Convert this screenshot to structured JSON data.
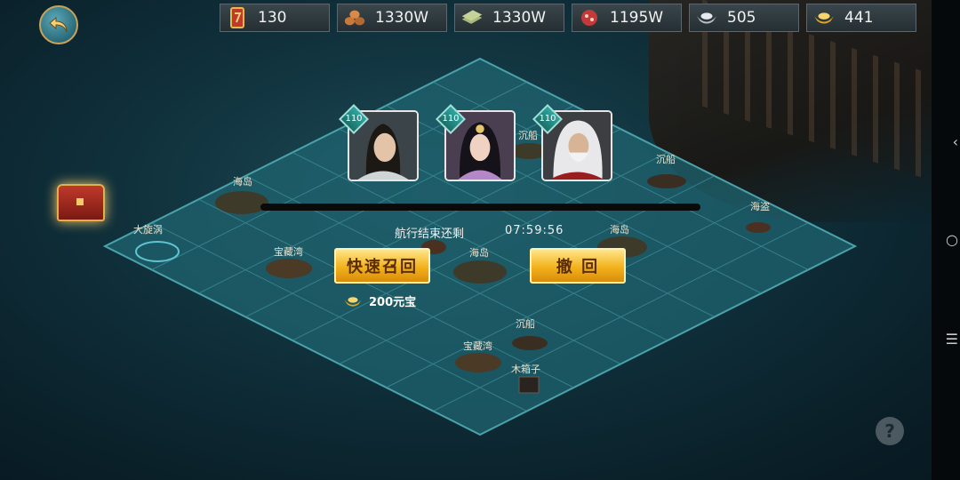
{
  "resources": [
    {
      "icon": "token-icon",
      "value": "130"
    },
    {
      "icon": "wood-icon",
      "value": "1330W"
    },
    {
      "icon": "cloth-icon",
      "value": "1330W"
    },
    {
      "icon": "meat-icon",
      "value": "1195W"
    },
    {
      "icon": "silver-ingot-icon",
      "value": "505"
    },
    {
      "icon": "gold-ingot-icon",
      "value": "441"
    }
  ],
  "heroes": [
    {
      "level": "110"
    },
    {
      "level": "110"
    },
    {
      "level": "110"
    }
  ],
  "map_labels": [
    "海岛",
    "大旋涡",
    "宝藏湾",
    "海岛",
    "沉船",
    "海盗",
    "海岛",
    "沉船",
    "宝藏湾",
    "木箱子",
    "沉船"
  ],
  "voyage": {
    "label": "航行结束还剩",
    "time": "07:59:56"
  },
  "buttons": {
    "quick_recall": "快速召回",
    "withdraw": "撤 回"
  },
  "cost": {
    "amount": "200元宝",
    "icon": "gold-ingot-icon"
  },
  "help_symbol": "?",
  "colors": {
    "button": "#f2b21c",
    "sea": "#1c4a55",
    "grid_line": "#3c8a92"
  }
}
